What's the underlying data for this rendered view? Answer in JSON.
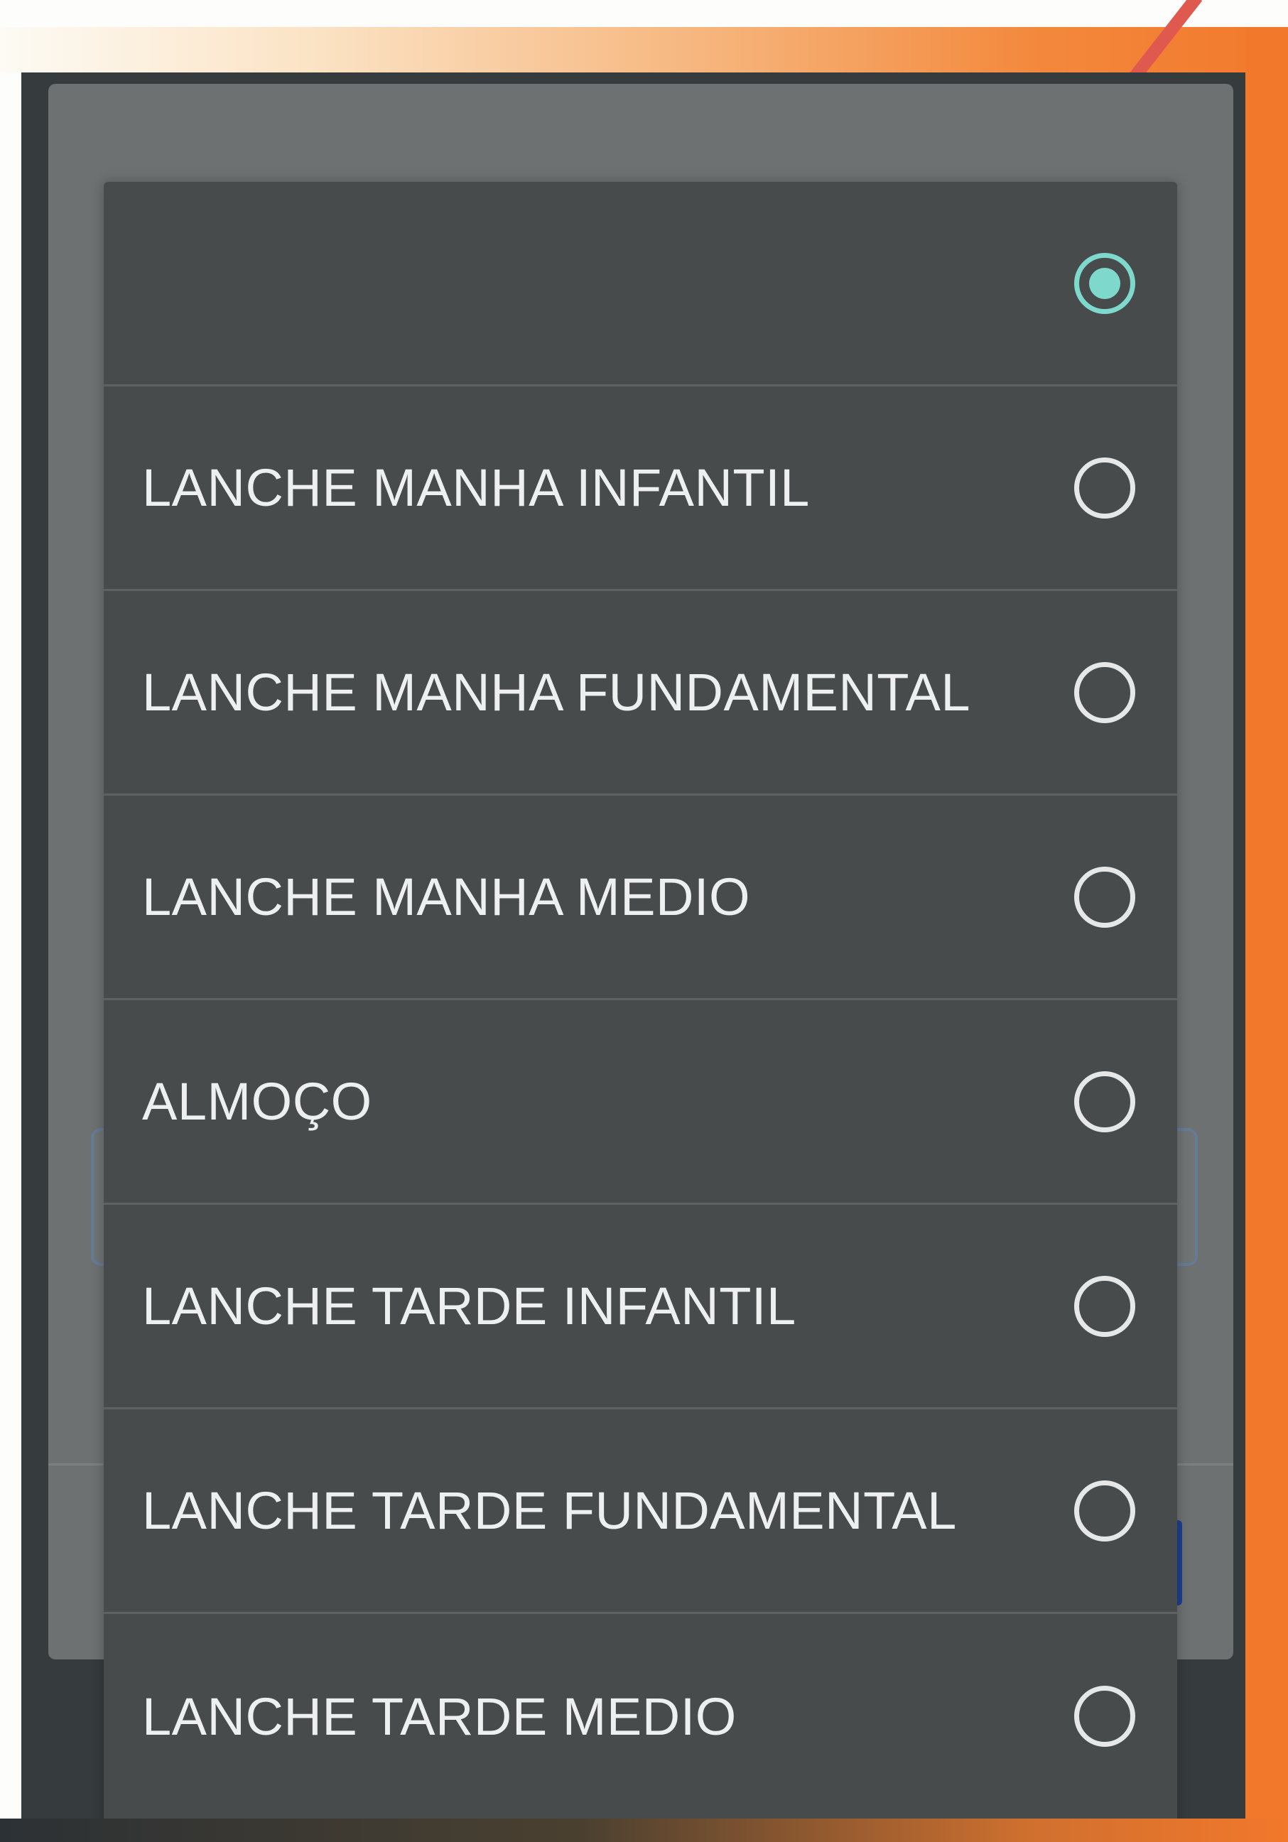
{
  "options": [
    {
      "label": "",
      "selected": true
    },
    {
      "label": "LANCHE MANHA INFANTIL",
      "selected": false
    },
    {
      "label": "LANCHE MANHA FUNDAMENTAL",
      "selected": false
    },
    {
      "label": "LANCHE MANHA MEDIO",
      "selected": false
    },
    {
      "label": "ALMOÇO",
      "selected": false
    },
    {
      "label": "LANCHE TARDE INFANTIL",
      "selected": false
    },
    {
      "label": "LANCHE TARDE FUNDAMENTAL",
      "selected": false
    },
    {
      "label": "LANCHE TARDE MEDIO",
      "selected": false
    }
  ],
  "colors": {
    "accent": "#7fd8cc",
    "frame": "#f2782b",
    "panel": "#474b4c",
    "dim_overlay": "#6d7172"
  }
}
